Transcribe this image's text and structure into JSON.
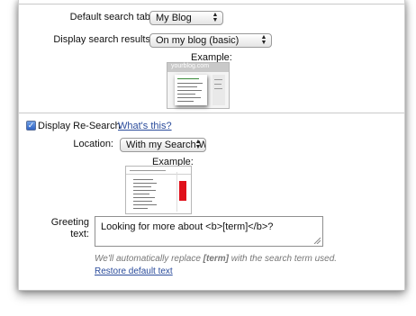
{
  "search": {
    "default_tab_label": "Default search tab:",
    "default_tab_value": "My Blog",
    "display_results_label": "Display search results:",
    "display_results_value": "On my blog (basic)",
    "example_label": "Example:",
    "example_thumb_header": "yourblog.com"
  },
  "research": {
    "checkbox_label": "Display Re-Search",
    "checked": true,
    "whats_this": "What's this?",
    "location_label": "Location:",
    "location_value": "With my Search Wijit",
    "example_label": "Example:",
    "greeting_label_1": "Greeting",
    "greeting_label_2": "text:",
    "greeting_value": "Looking for more about <b>[term]</b>?",
    "hint_before": "We'll automatically replace ",
    "hint_term": "[term]",
    "hint_after": " with the search term used.",
    "restore_link": "Restore default text"
  },
  "icons": {
    "select_arrows": "updown-arrows-icon",
    "checkbox": "checkmark-icon",
    "resize": "resize-grip-icon"
  },
  "colors": {
    "link": "#2a4b9b",
    "wijit_red": "#e0101a",
    "checkbox_blue": "#3a6fcf"
  }
}
